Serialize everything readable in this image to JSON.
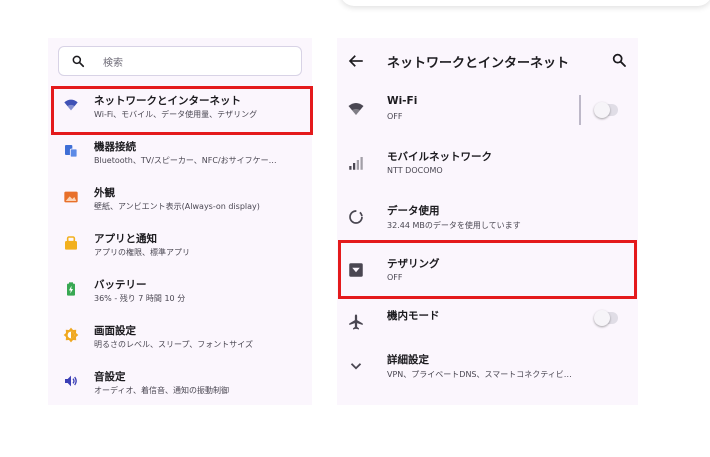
{
  "left": {
    "search_placeholder": "検索",
    "items": [
      {
        "title": "ネットワークとインターネット",
        "sub": "Wi-Fi、モバイル、データ使用量、テザリング",
        "icon": "wifi-icon",
        "color": "#3f51b5"
      },
      {
        "title": "機器接続",
        "sub": "Bluetooth、TV/スピーカー、NFC/おサイフケー…",
        "icon": "devices-icon",
        "color": "#3f6fd6"
      },
      {
        "title": "外観",
        "sub": "壁紙、アンビエント表示(Always-on display)",
        "icon": "wallpaper-icon",
        "color": "#e8702a"
      },
      {
        "title": "アプリと通知",
        "sub": "アプリの権限、標準アプリ",
        "icon": "apps-icon",
        "color": "#f2b01e"
      },
      {
        "title": "バッテリー",
        "sub": "36% - 残り 7 時間 10 分",
        "icon": "battery-icon",
        "color": "#38a853"
      },
      {
        "title": "画面設定",
        "sub": "明るさのレベル、スリープ、フォントサイズ",
        "icon": "brightness-icon",
        "color": "#f0a820"
      },
      {
        "title": "音設定",
        "sub": "オーディオ、着信音、通知の振動制御",
        "icon": "sound-icon",
        "color": "#3b3fb6"
      }
    ]
  },
  "right": {
    "title": "ネットワークとインターネット",
    "items": [
      {
        "title": "Wi-Fi",
        "sub": "OFF",
        "icon": "wifi-icon"
      },
      {
        "title": "モバイルネットワーク",
        "sub": "NTT DOCOMO",
        "icon": "signal-icon"
      },
      {
        "title": "データ使用",
        "sub": "32.44 MBのデータを使用しています",
        "icon": "data-usage-icon"
      },
      {
        "title": "テザリング",
        "sub": "OFF",
        "icon": "tethering-icon"
      },
      {
        "title": "機内モード",
        "sub": "",
        "icon": "airplane-icon"
      },
      {
        "title": "詳細設定",
        "sub": "VPN、プライベートDNS、スマートコネクティビ…",
        "icon": "chevron-down-icon"
      }
    ]
  },
  "colors": {
    "highlight": "#e41a1c",
    "panel_bg": "#fbf6fd",
    "icon_gray": "#4a4752"
  }
}
